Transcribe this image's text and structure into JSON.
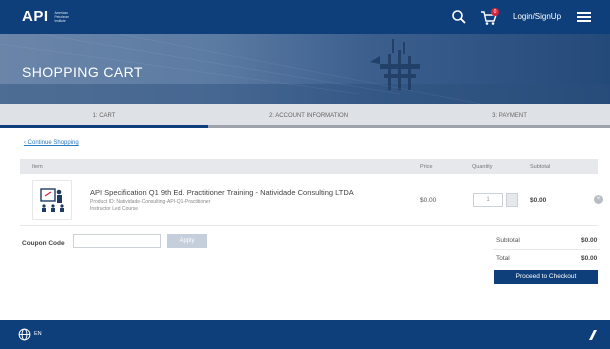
{
  "header": {
    "logo": "API",
    "logo_sub": "American Petroleum Institute",
    "login_label": "Login/SignUp",
    "cart_count": "0"
  },
  "hero": {
    "title": "SHOPPING CART"
  },
  "steps": [
    {
      "label": "1: CART"
    },
    {
      "label": "2: ACCOUNT INFORMATION"
    },
    {
      "label": "3: PAYMENT"
    }
  ],
  "continue_label": "Continue Shopping",
  "table": {
    "headers": {
      "item": "Item",
      "price": "Price",
      "quantity": "Quantity",
      "subtotal": "Subtotal"
    },
    "rows": [
      {
        "title": "API Specification Q1 9th Ed. Practitioner Training - Natividade Consulting LTDA",
        "sub1": "Product ID: Natividade-Consulting-API-Q1-Practitioner",
        "sub2": "Instructor Led Course",
        "price": "$0.00",
        "quantity": "1",
        "subtotal": "$0.00"
      }
    ]
  },
  "coupon": {
    "label": "Coupon Code",
    "placeholder": "",
    "apply_label": "Apply"
  },
  "summary": {
    "subtotal_label": "Subtotal",
    "subtotal_value": "$0.00",
    "total_label": "Total",
    "total_value": "$0.00",
    "checkout_label": "Proceed to Checkout"
  },
  "footer": {
    "lang": "EN"
  },
  "colors": {
    "brand": "#0f3f7a",
    "link": "#2a7ac0"
  }
}
